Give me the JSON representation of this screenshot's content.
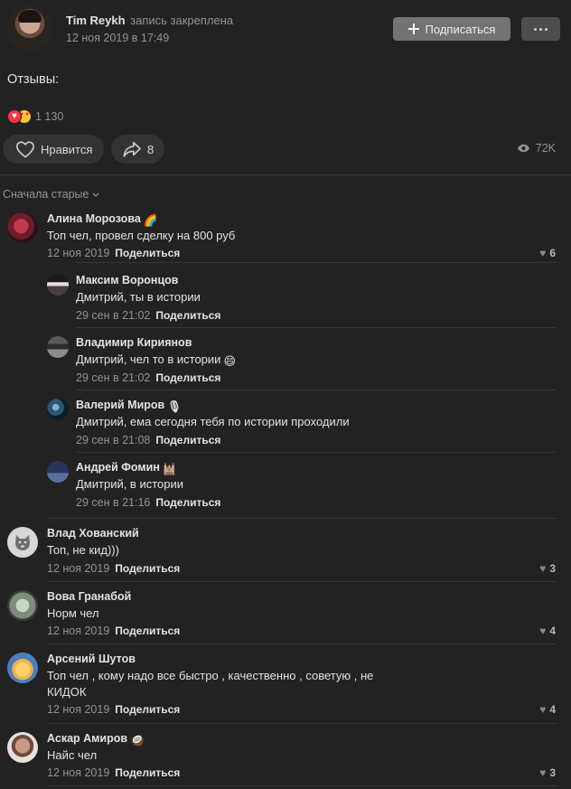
{
  "post": {
    "author_name": "Tim Reykh",
    "author_action": "запись закреплена",
    "date": "12 ноя 2019 в 17:49",
    "subscribe_label": "Подписаться",
    "text": "Отзывы:",
    "reactions_count": "1 130",
    "like_label": "Нравится",
    "share_count": "8",
    "views": "72K"
  },
  "sort_label": "Сначала старые",
  "comments": [
    {
      "name": "Алина Морозова",
      "emoji": "🌈",
      "text": "Топ чел, провел сделку на 800 руб",
      "date": "12 ноя 2019",
      "share": "Поделиться",
      "likes": "6"
    },
    {
      "name": "Максим Воронцов",
      "text": "Дмитрий, ты в истории",
      "date": "29 сен в 21:02",
      "share": "Поделиться"
    },
    {
      "name": "Владимир Кириянов",
      "text": "Дмитрий, чел то в истории",
      "text_emoji": "😄",
      "date": "29 сен в 21:02",
      "share": "Поделиться"
    },
    {
      "name": "Валерий Миров",
      "emoji": "🎙",
      "text": "Дмитрий, ема сегодня тебя по истории проходили",
      "date": "29 сен в 21:08",
      "share": "Поделиться"
    },
    {
      "name": "Андрей Фомин",
      "emoji": "🕍",
      "text": "Дмитрий, в истории",
      "date": "29 сен в 21:16",
      "share": "Поделиться"
    },
    {
      "name": "Влад Хованский",
      "text": "Топ, не кид)))",
      "date": "12 ноя 2019",
      "share": "Поделиться",
      "likes": "3"
    },
    {
      "name": "Вова Гранабой",
      "text": "Норм чел",
      "date": "12 ноя 2019",
      "share": "Поделиться",
      "likes": "4"
    },
    {
      "name": "Арсений Шутов",
      "text": "Топ чел , кому надо все быстро , качественно , советую , не КИДОК",
      "date": "12 ноя 2019",
      "share": "Поделиться",
      "likes": "4"
    },
    {
      "name": "Аскар Амиров",
      "emoji": "🥥",
      "text": "Найс чел",
      "date": "12 ноя 2019",
      "share": "Поделиться",
      "likes": "3"
    }
  ],
  "colors": {
    "background": "#222222",
    "text": "#e1e3e6",
    "muted": "#939393",
    "pill": "#333333",
    "subscribe_bg": "#737373"
  }
}
